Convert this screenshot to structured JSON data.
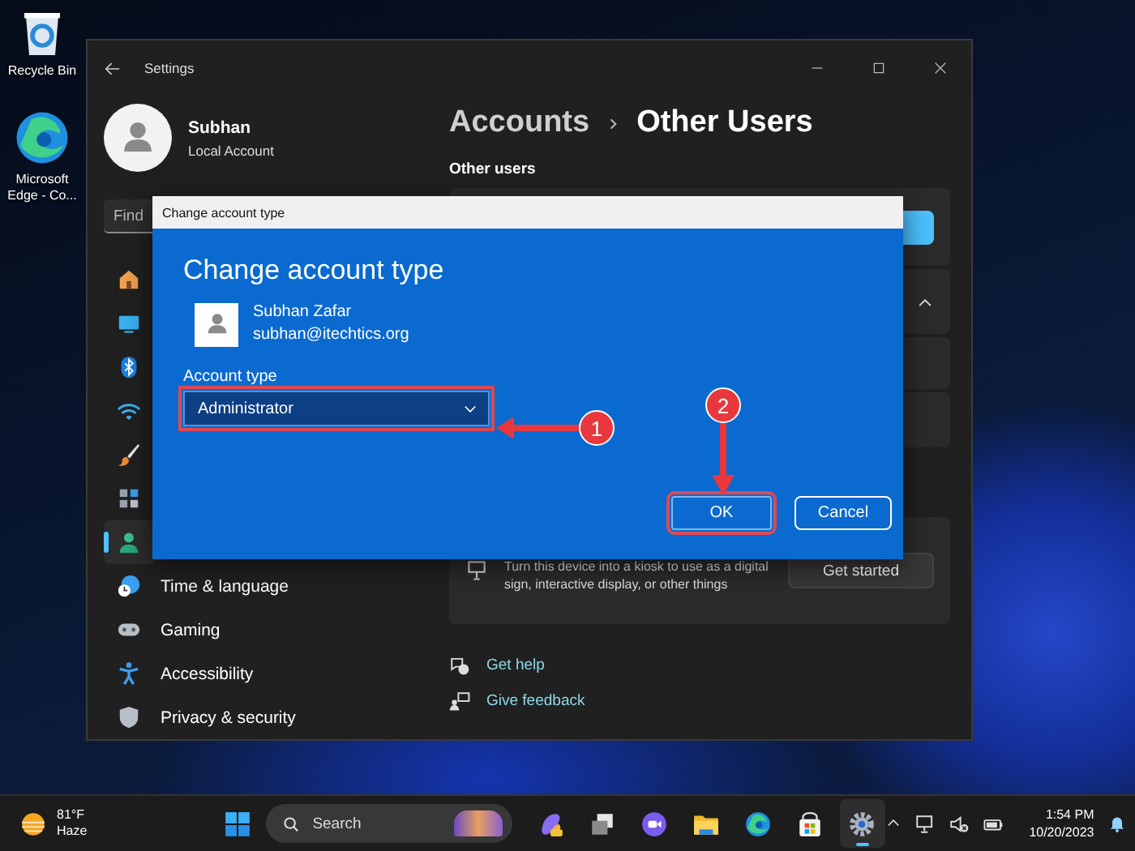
{
  "desktop": {
    "icons": [
      {
        "kind": "recycle",
        "label": "Recycle Bin"
      },
      {
        "kind": "browser",
        "label": "Microsoft Edge - Co..."
      }
    ]
  },
  "settings": {
    "title": "Settings",
    "user": {
      "name": "Subhan",
      "account": "Local Account"
    },
    "search": {
      "placeholder": "Find"
    },
    "nav": [
      {
        "kind": "home",
        "selected": false
      },
      {
        "kind": "system",
        "selected": false
      },
      {
        "kind": "bluetooth",
        "selected": false
      },
      {
        "kind": "wifi",
        "selected": false
      },
      {
        "kind": "brush",
        "selected": false
      },
      {
        "kind": "apps",
        "selected": false
      },
      {
        "kind": "accounts",
        "selected": true
      },
      {
        "kind": "time",
        "label": "Time & language",
        "selected": false
      },
      {
        "kind": "gaming",
        "label": "Gaming",
        "selected": false
      },
      {
        "kind": "accessibility",
        "label": "Accessibility",
        "selected": false
      },
      {
        "kind": "privacy",
        "label": "Privacy & security",
        "selected": false
      }
    ],
    "breadcrumb": [
      "Accounts",
      "Other Users"
    ],
    "section": "Other users",
    "kiosk": {
      "description": "Turn this device into a kiosk to use as a digital sign, interactive display, or other things",
      "button": "Get started"
    },
    "links": [
      {
        "kind": "help",
        "label": "Get help"
      },
      {
        "kind": "feedback",
        "label": "Give feedback"
      }
    ]
  },
  "dialog": {
    "title": "Change account type",
    "heading": "Change account type",
    "user": {
      "name": "Subhan Zafar",
      "email": "subhan@itechtics.org"
    },
    "field_label": "Account type",
    "dropdown": {
      "value": "Administrator"
    },
    "buttons": [
      {
        "label": "OK",
        "kind": "primary"
      },
      {
        "label": "Cancel",
        "kind": "secondary"
      }
    ],
    "annotations": [
      {
        "number": "1",
        "kind": "left"
      },
      {
        "number": "2",
        "kind": "down"
      }
    ]
  },
  "taskbar": {
    "weather": {
      "temp": "81°F",
      "condition": "Haze"
    },
    "search": {
      "placeholder": "Search"
    },
    "apps": [
      {
        "kind": "copilot",
        "active": false
      },
      {
        "kind": "taskview",
        "active": false
      },
      {
        "kind": "meet",
        "active": false
      },
      {
        "kind": "folder",
        "active": false
      },
      {
        "kind": "browser",
        "active": false
      },
      {
        "kind": "store",
        "active": false
      },
      {
        "kind": "gear",
        "active": true
      }
    ],
    "clock": {
      "time": "1:54 PM",
      "date": "10/20/2023"
    }
  }
}
